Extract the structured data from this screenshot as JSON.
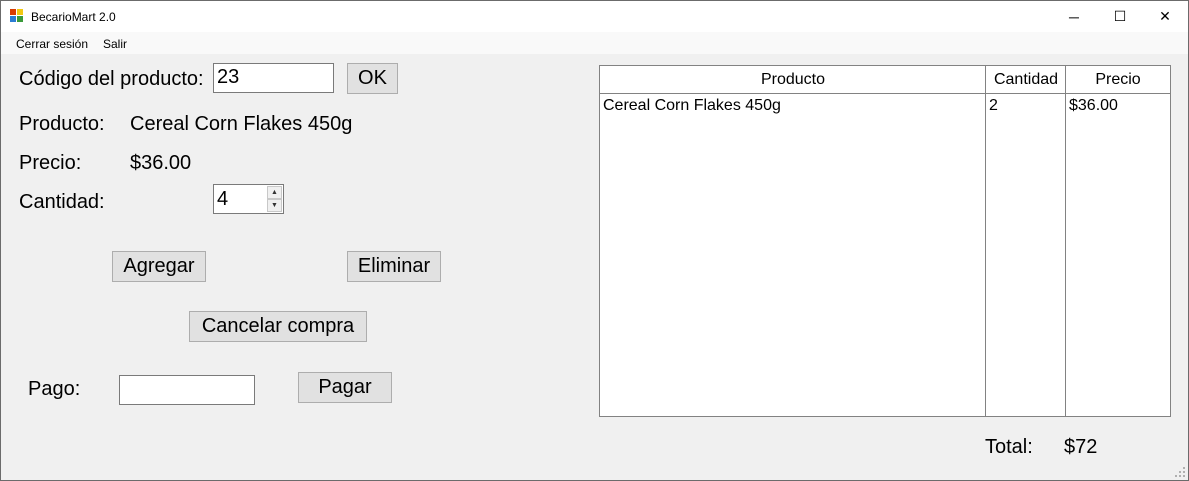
{
  "window": {
    "title": "BecarioMart 2.0",
    "controls": {
      "minimize": "─",
      "maximize": "☐",
      "close": "✕"
    }
  },
  "menu": {
    "items": [
      "Cerrar sesión",
      "Salir"
    ]
  },
  "form": {
    "code_label": "Código del producto:",
    "code_value": "23",
    "ok_button": "OK",
    "product_label": "Producto:",
    "product_value": "Cereal Corn Flakes 450g",
    "price_label": "Precio:",
    "price_value": "$36.00",
    "quantity_label": "Cantidad:",
    "quantity_value": "4",
    "add_button": "Agregar",
    "remove_button": "Eliminar",
    "cancel_button": "Cancelar compra",
    "payment_label": "Pago:",
    "payment_value": "",
    "pay_button": "Pagar"
  },
  "cart": {
    "columns": [
      "Producto",
      "Cantidad",
      "Precio"
    ],
    "rows": [
      [
        "Cereal Corn Flakes 450g",
        "2",
        "$36.00"
      ]
    ]
  },
  "total": {
    "label": "Total:",
    "value": "$72"
  },
  "colors": {
    "window_bg": "#f0f0f0",
    "button_bg": "#e1e1e1",
    "border": "#7a7a7a"
  }
}
